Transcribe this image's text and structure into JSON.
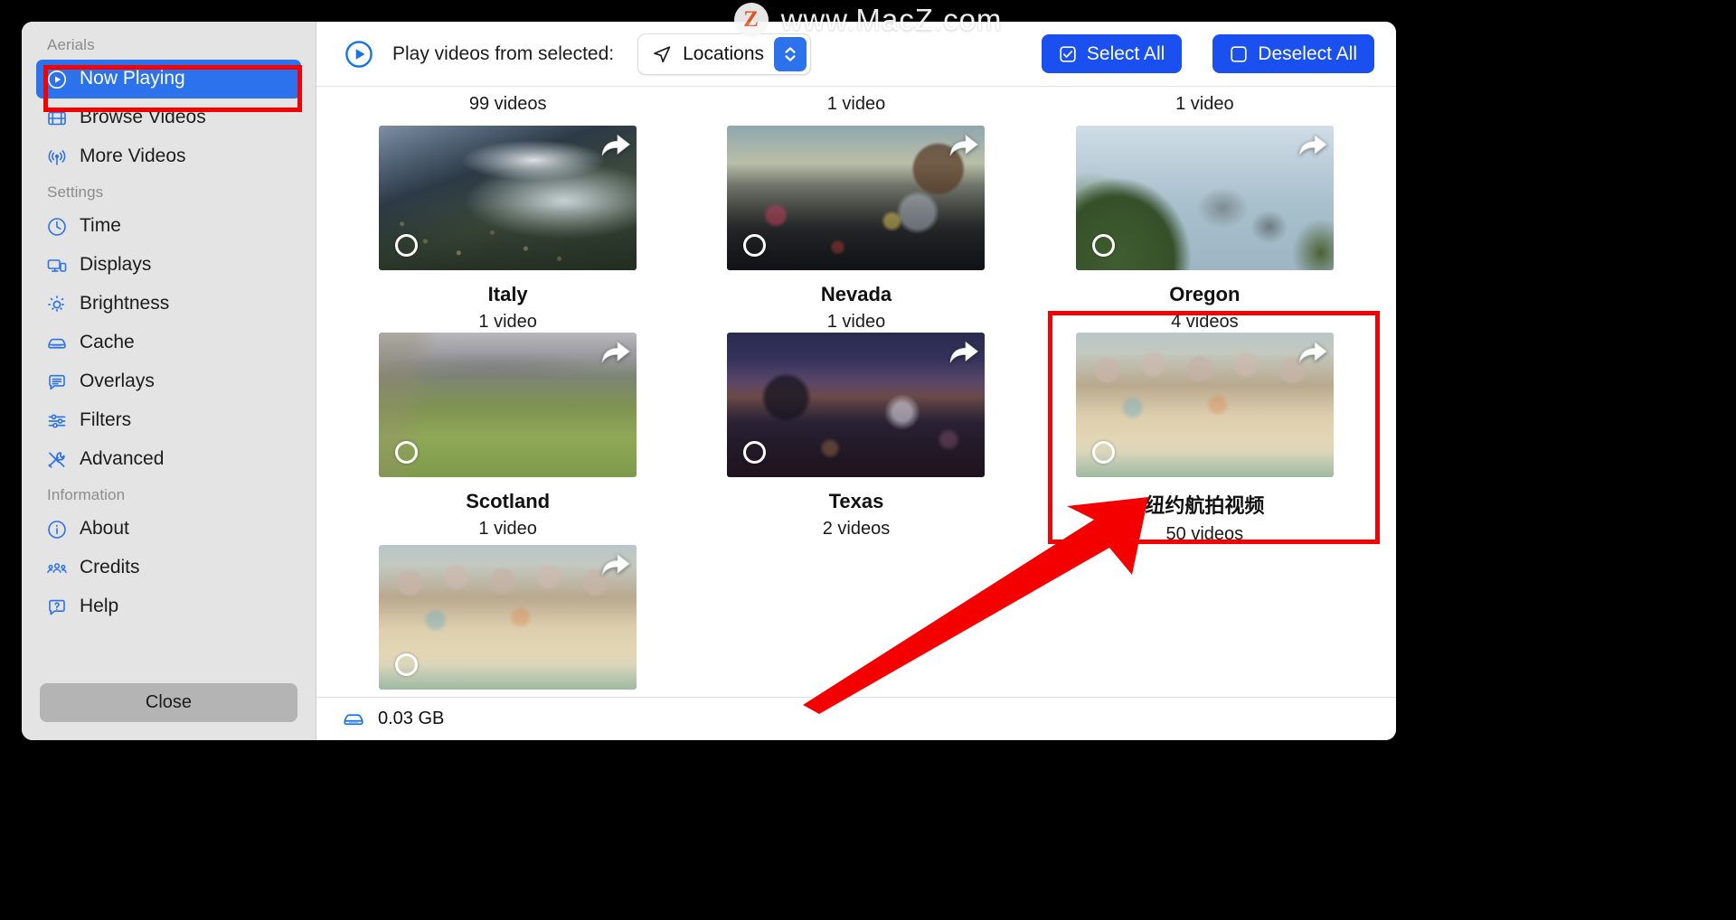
{
  "watermark": {
    "badge": "Z",
    "text": "www.MacZ.com"
  },
  "sidebar": {
    "sections": [
      {
        "header": "Aerials",
        "items": [
          {
            "label": "Now Playing",
            "icon": "play-circle-icon",
            "active": true
          },
          {
            "label": "Browse Videos",
            "icon": "film-icon",
            "active": false
          },
          {
            "label": "More Videos",
            "icon": "antenna-icon",
            "active": false
          }
        ]
      },
      {
        "header": "Settings",
        "items": [
          {
            "label": "Time",
            "icon": "clock-icon",
            "active": false
          },
          {
            "label": "Displays",
            "icon": "displays-icon",
            "active": false
          },
          {
            "label": "Brightness",
            "icon": "brightness-icon",
            "active": false
          },
          {
            "label": "Cache",
            "icon": "disk-icon",
            "active": false
          },
          {
            "label": "Overlays",
            "icon": "bubble-icon",
            "active": false
          },
          {
            "label": "Filters",
            "icon": "sliders-icon",
            "active": false
          },
          {
            "label": "Advanced",
            "icon": "tools-icon",
            "active": false
          }
        ]
      },
      {
        "header": "Information",
        "items": [
          {
            "label": "About",
            "icon": "info-icon",
            "active": false
          },
          {
            "label": "Credits",
            "icon": "people-icon",
            "active": false
          },
          {
            "label": "Help",
            "icon": "help-icon",
            "active": false
          }
        ]
      }
    ],
    "close_label": "Close"
  },
  "toolbar": {
    "play_icon": "play-circle-icon",
    "label": "Play videos from selected:",
    "select": {
      "icon": "location-arrow-icon",
      "value": "Locations",
      "stepper_icon": "chevron-updown-icon"
    },
    "select_all_label": "Select All",
    "select_all_icon": "checkbox-checked-icon",
    "deselect_all_label": "Deselect All",
    "deselect_all_icon": "checkbox-empty-icon",
    "accent_color": "#1a4ff0"
  },
  "grid": {
    "partial_top_row": [
      {
        "count": "99 videos"
      },
      {
        "count": "1 video"
      },
      {
        "count": "1 video"
      }
    ],
    "items": [
      {
        "title": "Italy",
        "count": "1 video",
        "art": "art-italy",
        "share_icon": "share-arrow-icon",
        "radio_icon": "radio-unchecked-icon"
      },
      {
        "title": "Nevada",
        "count": "1 video",
        "art": "art-vegas",
        "share_icon": "share-arrow-icon",
        "radio_icon": "radio-unchecked-icon"
      },
      {
        "title": "Oregon",
        "count": "4 videos",
        "art": "art-oregon",
        "share_icon": "share-arrow-icon",
        "radio_icon": "radio-unchecked-icon"
      },
      {
        "title": "Scotland",
        "count": "1 video",
        "art": "art-scotland",
        "share_icon": "share-arrow-icon",
        "radio_icon": "radio-unchecked-icon"
      },
      {
        "title": "Texas",
        "count": "2 videos",
        "art": "art-texas",
        "share_icon": "share-arrow-icon",
        "radio_icon": "radio-unchecked-icon"
      },
      {
        "title": "纽约航拍视频",
        "count": "50 videos",
        "art": "art-nyc",
        "share_icon": "share-arrow-icon",
        "radio_icon": "radio-unchecked-icon"
      }
    ],
    "partial_bottom_row": [
      {
        "art": "art-nyc",
        "share_icon": "share-arrow-icon",
        "radio_icon": "radio-unchecked-icon"
      }
    ]
  },
  "statusbar": {
    "icon": "disk-icon",
    "text": "0.03 GB"
  },
  "annotations": {
    "color": "#f40000",
    "boxes": [
      "now-playing-highlight",
      "nyc-item-highlight"
    ],
    "arrow": "pointer-arrow"
  }
}
